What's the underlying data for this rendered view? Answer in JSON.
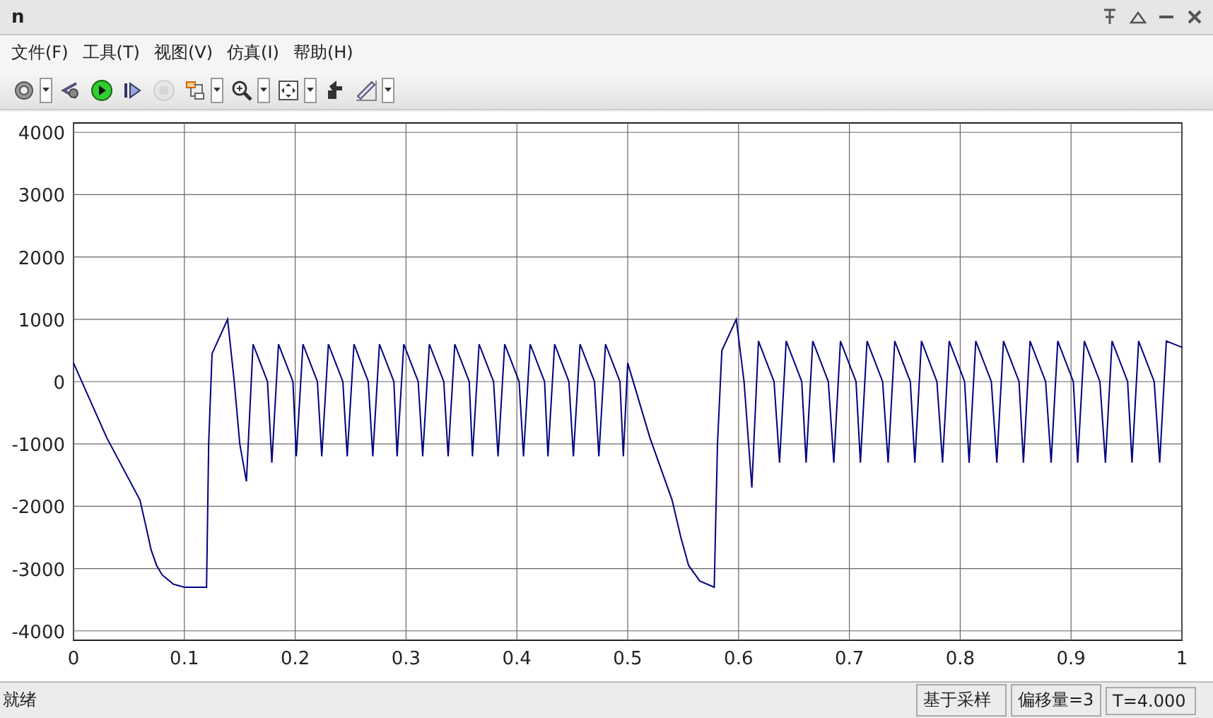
{
  "window": {
    "title": "n"
  },
  "menu": [
    "文件(F)",
    "工具(T)",
    "视图(V)",
    "仿真(I)",
    "帮助(H)"
  ],
  "toolbar": [
    {
      "kind": "gear",
      "dropdown": true,
      "disabled": false
    },
    {
      "kind": "binoculars",
      "dropdown": false,
      "disabled": false
    },
    {
      "kind": "play",
      "dropdown": false,
      "disabled": false
    },
    {
      "kind": "step",
      "dropdown": false,
      "disabled": false
    },
    {
      "kind": "stop",
      "dropdown": false,
      "disabled": true
    },
    {
      "kind": "blocks",
      "dropdown": true,
      "disabled": false
    },
    {
      "kind": "zoom",
      "dropdown": true,
      "disabled": false
    },
    {
      "kind": "fit",
      "dropdown": true,
      "disabled": false
    },
    {
      "kind": "arrow",
      "dropdown": false,
      "disabled": false
    },
    {
      "kind": "ruler",
      "dropdown": true,
      "disabled": false
    }
  ],
  "plot": {
    "chart_data": {
      "type": "line",
      "grid": true,
      "xlim": [
        0,
        1
      ],
      "ylim": [
        -4150,
        4150
      ],
      "xticks": [
        {
          "value": 0,
          "label": "0"
        },
        {
          "value": 0.1,
          "label": "0.1"
        },
        {
          "value": 0.2,
          "label": "0.2"
        },
        {
          "value": 0.3,
          "label": "0.3"
        },
        {
          "value": 0.4,
          "label": "0.4"
        },
        {
          "value": 0.5,
          "label": "0.5"
        },
        {
          "value": 0.6,
          "label": "0.6"
        },
        {
          "value": 0.7,
          "label": "0.7"
        },
        {
          "value": 0.8,
          "label": "0.8"
        },
        {
          "value": 0.9,
          "label": "0.9"
        },
        {
          "value": 1,
          "label": "1"
        }
      ],
      "yticks": [
        {
          "value": -4000,
          "label": "-4000"
        },
        {
          "value": -3000,
          "label": "-3000"
        },
        {
          "value": -2000,
          "label": "-2000"
        },
        {
          "value": -1000,
          "label": "-1000"
        },
        {
          "value": 0,
          "label": "0"
        },
        {
          "value": 1000,
          "label": "1000"
        },
        {
          "value": 2000,
          "label": "2000"
        },
        {
          "value": 3000,
          "label": "3000"
        },
        {
          "value": 4000,
          "label": "4000"
        }
      ],
      "x": [
        0,
        0.03,
        0.06,
        0.065,
        0.07,
        0.075,
        0.08,
        0.09,
        0.1,
        0.12,
        0.122,
        0.125,
        0.139,
        0.145,
        0.15,
        0.156,
        0.162,
        0.175,
        0.179,
        0.185,
        0.198,
        0.201,
        0.207,
        0.22,
        0.224,
        0.23,
        0.243,
        0.247,
        0.253,
        0.266,
        0.27,
        0.276,
        0.289,
        0.292,
        0.298,
        0.311,
        0.315,
        0.321,
        0.334,
        0.338,
        0.344,
        0.357,
        0.36,
        0.366,
        0.379,
        0.383,
        0.389,
        0.402,
        0.406,
        0.412,
        0.425,
        0.428,
        0.434,
        0.447,
        0.451,
        0.457,
        0.47,
        0.474,
        0.48,
        0.493,
        0.496,
        0.5,
        0.52,
        0.54,
        0.548,
        0.555,
        0.565,
        0.578,
        0.581,
        0.585,
        0.598,
        0.605,
        0.612,
        0.618,
        0.632,
        0.637,
        0.643,
        0.657,
        0.661,
        0.667,
        0.681,
        0.686,
        0.692,
        0.706,
        0.71,
        0.716,
        0.73,
        0.735,
        0.741,
        0.755,
        0.759,
        0.765,
        0.779,
        0.784,
        0.79,
        0.804,
        0.808,
        0.814,
        0.828,
        0.833,
        0.839,
        0.853,
        0.857,
        0.863,
        0.877,
        0.882,
        0.888,
        0.902,
        0.906,
        0.912,
        0.926,
        0.931,
        0.937,
        0.951,
        0.955,
        0.961,
        0.975,
        0.98,
        0.986,
        1
      ],
      "series": [
        {
          "color": "#000080",
          "values": [
            300,
            -900,
            -1900,
            -2300,
            -2700,
            -2950,
            -3100,
            -3250,
            -3300,
            -3300,
            -1000,
            450,
            1000,
            0,
            -1000,
            -1600,
            600,
            0,
            -1300,
            600,
            0,
            -1200,
            600,
            0,
            -1200,
            600,
            0,
            -1200,
            600,
            0,
            -1200,
            600,
            0,
            -1200,
            600,
            0,
            -1200,
            600,
            0,
            -1200,
            600,
            0,
            -1200,
            600,
            0,
            -1200,
            600,
            0,
            -1200,
            600,
            0,
            -1200,
            600,
            0,
            -1200,
            600,
            0,
            -1200,
            600,
            0,
            -1200,
            300,
            -900,
            -1900,
            -2500,
            -2950,
            -3200,
            -3300,
            -1000,
            500,
            1000,
            0,
            -1700,
            650,
            0,
            -1300,
            650,
            0,
            -1300,
            650,
            0,
            -1300,
            650,
            0,
            -1300,
            650,
            0,
            -1300,
            650,
            0,
            -1300,
            650,
            0,
            -1300,
            650,
            0,
            -1300,
            650,
            0,
            -1300,
            650,
            0,
            -1300,
            650,
            0,
            -1300,
            650,
            0,
            -1300,
            650,
            0,
            -1300,
            650,
            0,
            -1300,
            650,
            0,
            -1300,
            650,
            550
          ]
        }
      ]
    }
  },
  "status_bar": {
    "message": "就绪",
    "panes": [
      "基于采样",
      "偏移量=3",
      "T=4.000"
    ]
  }
}
